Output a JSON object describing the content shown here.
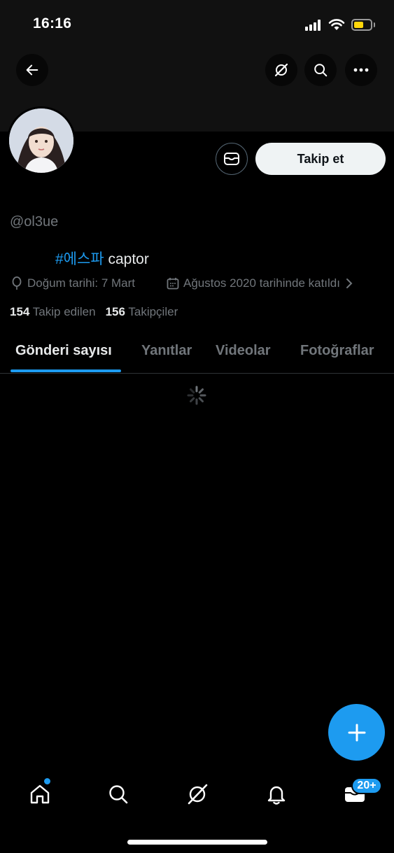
{
  "status_bar": {
    "time": "16:16"
  },
  "profile": {
    "handle": "@ol3ue",
    "bio_hashtag": "#에스파",
    "bio_text": " captor",
    "birth": "Doğum tarihi: 7 Mart",
    "joined": "Ağustos 2020 tarihinde katıldı",
    "following_count": "154",
    "following_label": "Takip edilen",
    "followers_count": "156",
    "followers_label": "Takipçiler"
  },
  "actions": {
    "follow_label": "Takip et"
  },
  "tabs": [
    {
      "label": "Gönderi sayısı",
      "active": true
    },
    {
      "label": "Yanıtlar",
      "active": false
    },
    {
      "label": "Videolar",
      "active": false
    },
    {
      "label": "Fotoğraflar",
      "active": false
    }
  ],
  "bottom_nav": {
    "items": [
      "home-icon",
      "search-icon",
      "grok-icon",
      "bell-icon",
      "mail-icon"
    ],
    "messages_badge": "20+"
  },
  "colors": {
    "accent": "#1d9bf0",
    "background": "#000000",
    "muted": "#71767b"
  }
}
